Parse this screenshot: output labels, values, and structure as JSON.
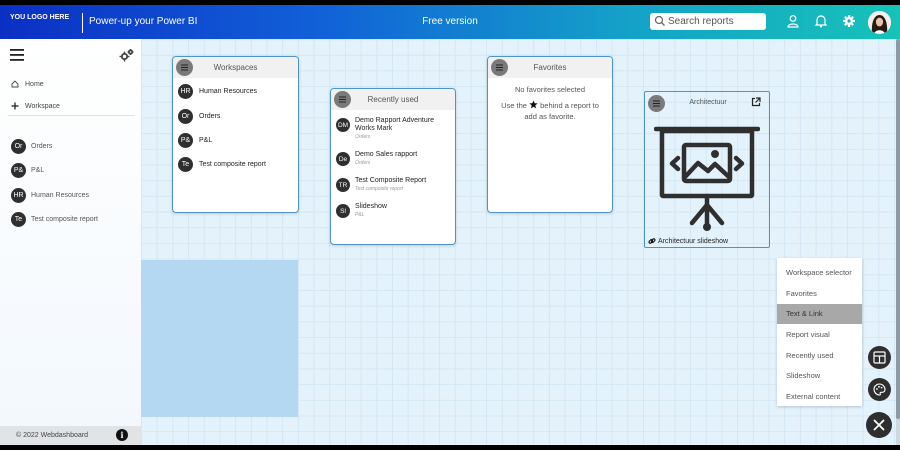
{
  "header": {
    "logo": "YOU LOGO HERE",
    "tagline": "Power-up your Power BI",
    "version": "Free version",
    "search_placeholder": "Search reports",
    "icons": [
      "search-icon",
      "user-icon",
      "bell-icon",
      "gear-icon",
      "avatar"
    ]
  },
  "sidebar": {
    "nav": [
      {
        "label": "Home",
        "icon": "home-icon"
      },
      {
        "label": "Workspace",
        "icon": "plus-icon"
      }
    ],
    "reports": [
      {
        "badge": "Or",
        "label": "Orders"
      },
      {
        "badge": "P&",
        "label": "P&L"
      },
      {
        "badge": "HR",
        "label": "Human Resources"
      },
      {
        "badge": "Te",
        "label": "Test composite report"
      }
    ],
    "footer": "© 2022 Webdashboard"
  },
  "widgets": {
    "workspaces": {
      "title": "Workspaces",
      "items": [
        {
          "badge": "HR",
          "label": "Human Resources"
        },
        {
          "badge": "Or",
          "label": "Orders"
        },
        {
          "badge": "P&",
          "label": "P&L"
        },
        {
          "badge": "Te",
          "label": "Test composite report"
        }
      ]
    },
    "recently_used": {
      "title": "Recently used",
      "items": [
        {
          "badge": "DM",
          "name": "Demo Rapport Adventure Works Mark",
          "sub": "Orders"
        },
        {
          "badge": "De",
          "name": "Demo Sales rapport",
          "sub": "Orders"
        },
        {
          "badge": "TR",
          "name": "Test Composite Report",
          "sub": "Test composite report"
        },
        {
          "badge": "Sl",
          "name": "Slideshow",
          "sub": "P&L"
        }
      ]
    },
    "favorites": {
      "title": "Favorites",
      "empty": "No favorites selected",
      "hint_before": "Use the",
      "hint_after": "behind a report to add as favorite."
    },
    "slideshow": {
      "title": "Architectuur",
      "caption": "Architectuur slideshow"
    }
  },
  "widget_menu": {
    "items": [
      "Workspace selector",
      "Favorites",
      "Text & Link",
      "Report visual",
      "Recently used",
      "Slideshow",
      "External content"
    ],
    "active": "Text & Link"
  },
  "colors": {
    "header_gradient_start": "#0b2fc4",
    "header_gradient_end": "#17c2b8",
    "card_border": "#4f93c9",
    "badge": "#2f2f2f",
    "menu_active": "#a8a8a8"
  }
}
